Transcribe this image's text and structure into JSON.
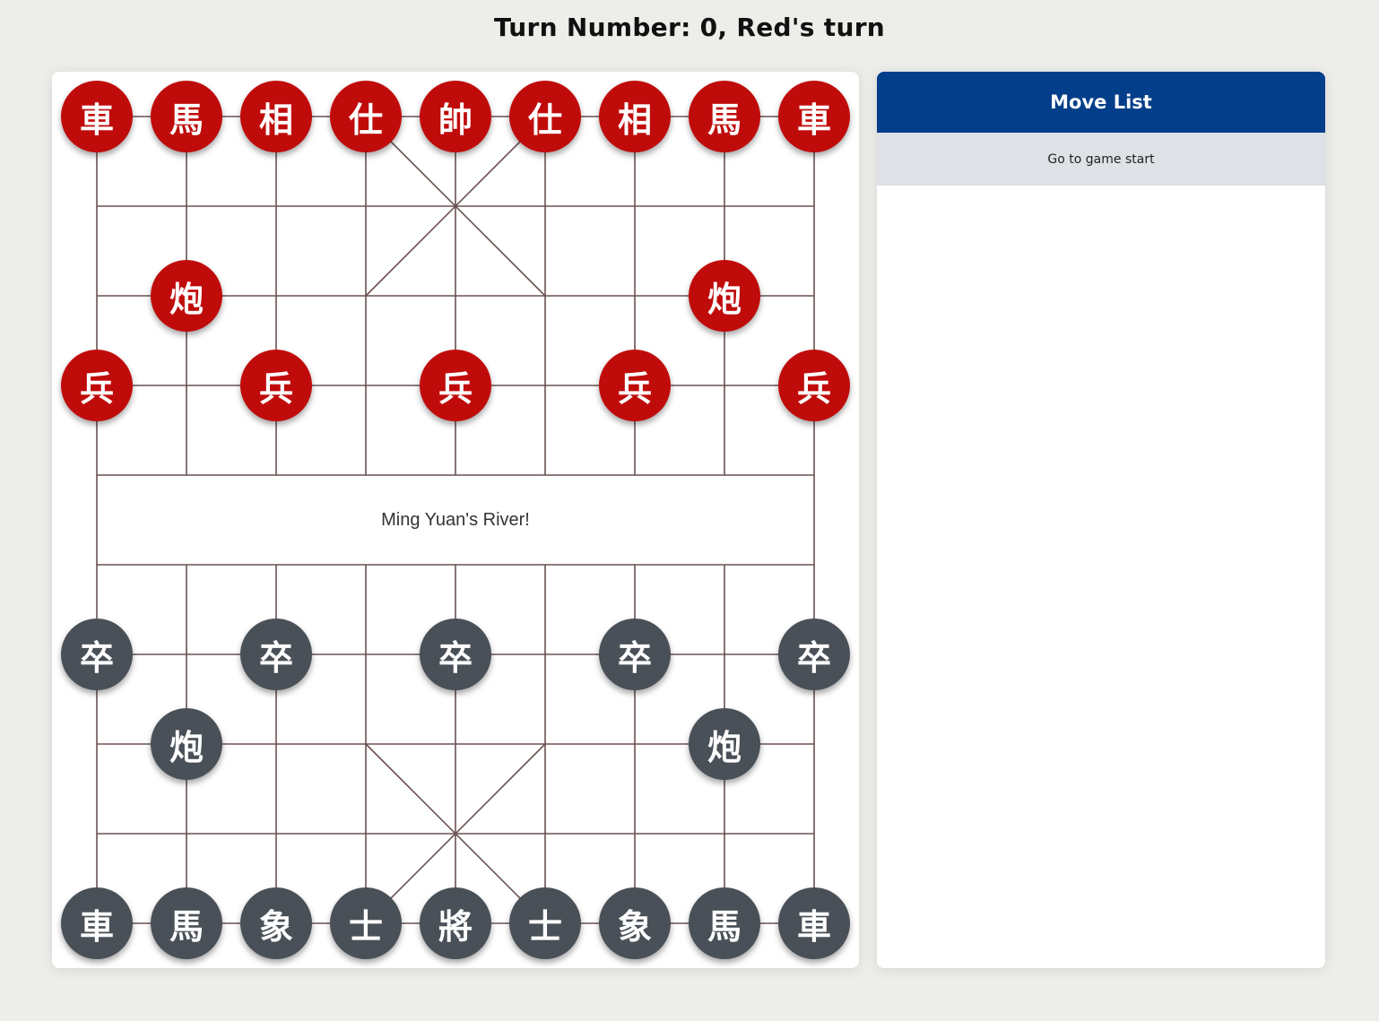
{
  "turn_title": "Turn Number: 0, Red's turn",
  "board": {
    "river_text": "Ming Yuan's River!",
    "line_color": "#6b5151",
    "red_color": "#c00b0b",
    "black_color": "#495057",
    "pieces": [
      {
        "id": "red-chariot-1",
        "char": "車",
        "side": "red",
        "col": 0,
        "row": 0
      },
      {
        "id": "red-horse-1",
        "char": "馬",
        "side": "red",
        "col": 1,
        "row": 0
      },
      {
        "id": "red-elephant-1",
        "char": "相",
        "side": "red",
        "col": 2,
        "row": 0
      },
      {
        "id": "red-advisor-1",
        "char": "仕",
        "side": "red",
        "col": 3,
        "row": 0
      },
      {
        "id": "red-general",
        "char": "帥",
        "side": "red",
        "col": 4,
        "row": 0
      },
      {
        "id": "red-advisor-2",
        "char": "仕",
        "side": "red",
        "col": 5,
        "row": 0
      },
      {
        "id": "red-elephant-2",
        "char": "相",
        "side": "red",
        "col": 6,
        "row": 0
      },
      {
        "id": "red-horse-2",
        "char": "馬",
        "side": "red",
        "col": 7,
        "row": 0
      },
      {
        "id": "red-chariot-2",
        "char": "車",
        "side": "red",
        "col": 8,
        "row": 0
      },
      {
        "id": "red-cannon-1",
        "char": "炮",
        "side": "red",
        "col": 1,
        "row": 2
      },
      {
        "id": "red-cannon-2",
        "char": "炮",
        "side": "red",
        "col": 7,
        "row": 2
      },
      {
        "id": "red-soldier-1",
        "char": "兵",
        "side": "red",
        "col": 0,
        "row": 3
      },
      {
        "id": "red-soldier-2",
        "char": "兵",
        "side": "red",
        "col": 2,
        "row": 3
      },
      {
        "id": "red-soldier-3",
        "char": "兵",
        "side": "red",
        "col": 4,
        "row": 3
      },
      {
        "id": "red-soldier-4",
        "char": "兵",
        "side": "red",
        "col": 6,
        "row": 3
      },
      {
        "id": "red-soldier-5",
        "char": "兵",
        "side": "red",
        "col": 8,
        "row": 3
      },
      {
        "id": "black-soldier-1",
        "char": "卒",
        "side": "black",
        "col": 0,
        "row": 6
      },
      {
        "id": "black-soldier-2",
        "char": "卒",
        "side": "black",
        "col": 2,
        "row": 6
      },
      {
        "id": "black-soldier-3",
        "char": "卒",
        "side": "black",
        "col": 4,
        "row": 6
      },
      {
        "id": "black-soldier-4",
        "char": "卒",
        "side": "black",
        "col": 6,
        "row": 6
      },
      {
        "id": "black-soldier-5",
        "char": "卒",
        "side": "black",
        "col": 8,
        "row": 6
      },
      {
        "id": "black-cannon-1",
        "char": "炮",
        "side": "black",
        "col": 1,
        "row": 7
      },
      {
        "id": "black-cannon-2",
        "char": "炮",
        "side": "black",
        "col": 7,
        "row": 7
      },
      {
        "id": "black-chariot-1",
        "char": "車",
        "side": "black",
        "col": 0,
        "row": 9
      },
      {
        "id": "black-horse-1",
        "char": "馬",
        "side": "black",
        "col": 1,
        "row": 9
      },
      {
        "id": "black-elephant-1",
        "char": "象",
        "side": "black",
        "col": 2,
        "row": 9
      },
      {
        "id": "black-advisor-1",
        "char": "士",
        "side": "black",
        "col": 3,
        "row": 9
      },
      {
        "id": "black-general",
        "char": "將",
        "side": "black",
        "col": 4,
        "row": 9
      },
      {
        "id": "black-advisor-2",
        "char": "士",
        "side": "black",
        "col": 5,
        "row": 9
      },
      {
        "id": "black-elephant-2",
        "char": "象",
        "side": "black",
        "col": 6,
        "row": 9
      },
      {
        "id": "black-horse-2",
        "char": "馬",
        "side": "black",
        "col": 7,
        "row": 9
      },
      {
        "id": "black-chariot-2",
        "char": "車",
        "side": "black",
        "col": 8,
        "row": 9
      }
    ]
  },
  "move_list": {
    "header": "Move List",
    "items": [
      {
        "label": "Go to game start"
      }
    ]
  }
}
